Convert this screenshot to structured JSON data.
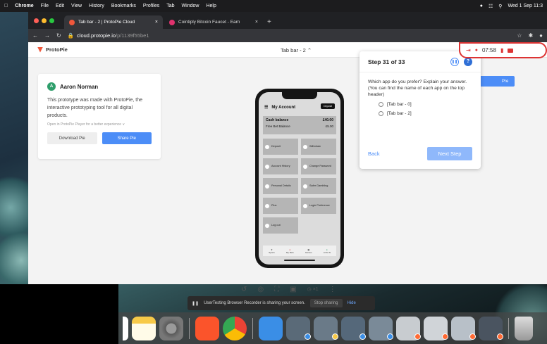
{
  "menubar": {
    "items": [
      "Chrome",
      "File",
      "Edit",
      "View",
      "History",
      "Bookmarks",
      "Profiles",
      "Tab",
      "Window",
      "Help"
    ],
    "clock": "Wed 1 Sep 11:3"
  },
  "browser": {
    "tabs": [
      {
        "title": "Tab bar - 2 | ProtoPie Cloud",
        "active": true,
        "favicon_color": "#f0573b"
      },
      {
        "title": "Cointiply Bitcoin Faucet - Earn",
        "active": false,
        "favicon_color": "#e0326e"
      }
    ],
    "new_tab": "+",
    "url_host": "cloud.protopie.io",
    "url_path": "/p/1139f55be1"
  },
  "protopie": {
    "logo": "ProtoPie",
    "scene_name": "Tab bar - 2 ⌃",
    "author_initial": "A",
    "author": "Aaron Norman",
    "description": "This prototype was made with ProtoPie, the interactive prototyping tool for all digital products.",
    "open_in": "Open in ProtoPie Player for a better experience ∨",
    "download_label": "Download Pie",
    "share_label": "Share Pie",
    "present_label": "Pre"
  },
  "phone_app": {
    "title": "My Account",
    "deposit_pill": "Deposit",
    "cash_balance_label": "Cash balance",
    "cash_balance_value": "£40.00",
    "free_bet_label": "Free Bet Balance",
    "free_bet_value": "£5.00",
    "menu": [
      "Deposit",
      "Withdraw",
      "Account History",
      "Change Password",
      "Personal Details",
      "Safer Gambling",
      "Plus",
      "Login Preference",
      "Log out"
    ],
    "tabs": [
      "Sports",
      "My Bets",
      "Games",
      "LOG IN"
    ]
  },
  "step": {
    "title": "Step 31 of 33",
    "question_line1": "Which app do you prefer? Explain your answer.",
    "question_line2": "(You can find the name of each app on the top header)",
    "options": [
      "[Tab bar - 0]",
      "[Tab bar - 2]"
    ],
    "back_label": "Back",
    "next_label": "Next Step"
  },
  "recorder": {
    "timer": "07:58"
  },
  "player_toolbar": {
    "zoom": "×1"
  },
  "sharebar": {
    "message": "UserTesting Browser Recorder is sharing your screen.",
    "stop_label": "Stop sharing",
    "hide_label": "Hide"
  },
  "dock": {
    "apps": [
      "Notes",
      "System Preferences",
      "Brave",
      "Chrome",
      "Finder Folder"
    ],
    "minimized_count": 8
  },
  "colors": {
    "accent": "#4c8df7",
    "protopie": "#f0573b",
    "record": "#dd3333"
  }
}
